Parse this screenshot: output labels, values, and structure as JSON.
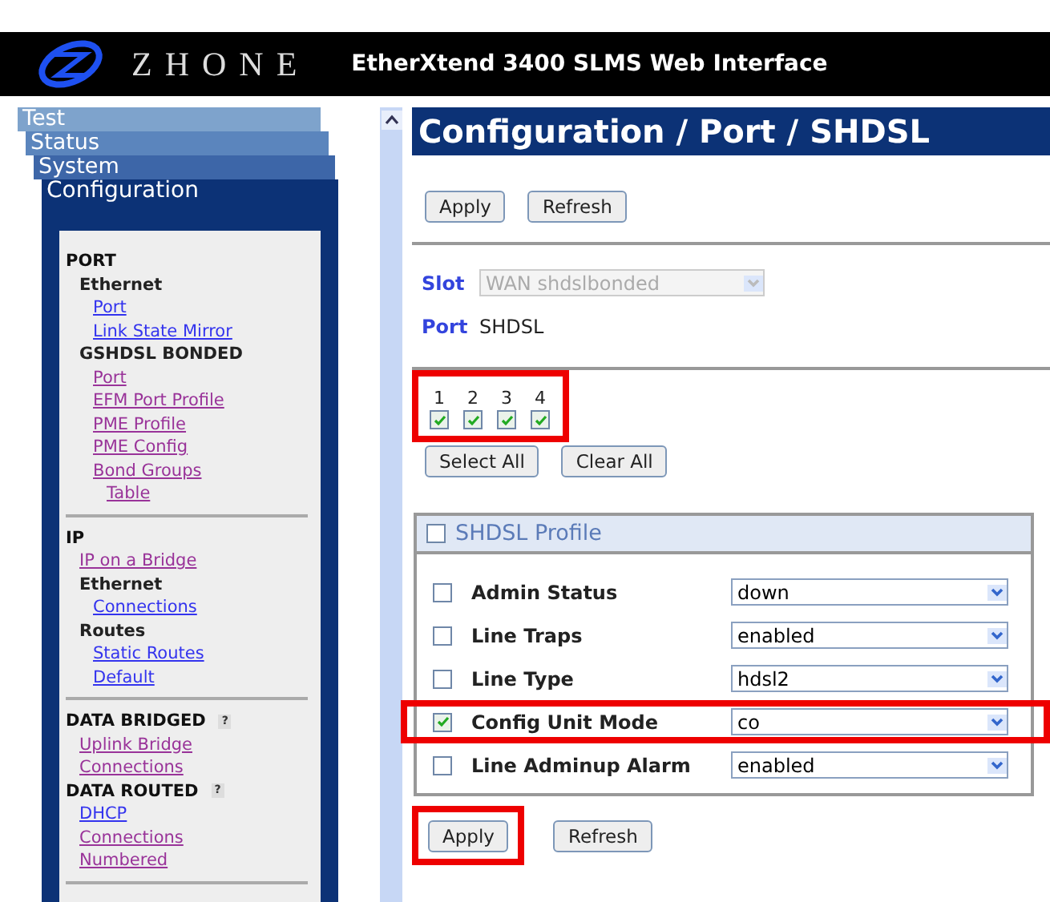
{
  "header": {
    "brand": "ZHONE",
    "title": "EtherXtend 3400 SLMS Web Interface"
  },
  "nav_tabs": [
    {
      "label": "Test",
      "selected": false
    },
    {
      "label": "Status",
      "selected": false
    },
    {
      "label": "System",
      "selected": false
    },
    {
      "label": "Configuration",
      "selected": true
    }
  ],
  "sidebar": {
    "sections": [
      {
        "items": [
          {
            "label": "PORT",
            "kind": "title",
            "children": [
              {
                "label": "Ethernet",
                "kind": "group",
                "children": [
                  {
                    "label": "Port",
                    "kind": "link",
                    "visited": false
                  },
                  {
                    "label": "Link State Mirror",
                    "kind": "link",
                    "visited": false
                  }
                ]
              },
              {
                "label": "GSHDSL BONDED",
                "kind": "group",
                "children": [
                  {
                    "label": "Port",
                    "kind": "link",
                    "visited": true
                  },
                  {
                    "label": "EFM Port Profile",
                    "kind": "link",
                    "visited": true
                  },
                  {
                    "label": "PME Profile",
                    "kind": "link",
                    "visited": true
                  },
                  {
                    "label": "PME Config",
                    "kind": "link",
                    "visited": true
                  },
                  {
                    "label": "Bond Groups",
                    "kind": "link",
                    "visited": true,
                    "children": [
                      {
                        "label": "Table",
                        "kind": "link",
                        "visited": true
                      }
                    ]
                  }
                ]
              }
            ]
          }
        ]
      },
      {
        "items": [
          {
            "label": "IP",
            "kind": "title",
            "children": [
              {
                "label": "IP on a Bridge",
                "kind": "link",
                "visited": true
              },
              {
                "label": "Ethernet",
                "kind": "group",
                "children": [
                  {
                    "label": "Connections",
                    "kind": "link",
                    "visited": false
                  }
                ]
              },
              {
                "label": "Routes",
                "kind": "group",
                "children": [
                  {
                    "label": "Static Routes",
                    "kind": "link",
                    "visited": false
                  },
                  {
                    "label": "Default",
                    "kind": "link",
                    "visited": false
                  }
                ]
              }
            ]
          }
        ]
      },
      {
        "items": [
          {
            "label": "DATA BRIDGED",
            "kind": "title",
            "help": "?",
            "children": [
              {
                "label": "Uplink Bridge",
                "kind": "link",
                "visited": true
              },
              {
                "label": "Connections",
                "kind": "link",
                "visited": true
              }
            ]
          },
          {
            "label": "DATA ROUTED",
            "kind": "title",
            "help": "?",
            "children": [
              {
                "label": "DHCP",
                "kind": "link",
                "visited": false
              },
              {
                "label": "Connections",
                "kind": "link",
                "visited": true
              },
              {
                "label": "Numbered",
                "kind": "link",
                "visited": true
              }
            ]
          }
        ]
      }
    ]
  },
  "page_title": "Configuration / Port / SHDSL",
  "top_buttons": [
    "Apply",
    "Refresh"
  ],
  "slot": {
    "label": "Slot",
    "value": "WAN shdslbonded",
    "disabled": true
  },
  "port": {
    "label": "Port",
    "value": "SHDSL"
  },
  "port_checks": {
    "highlight": true,
    "items": [
      {
        "label": "1",
        "checked": true
      },
      {
        "label": "2",
        "checked": true
      },
      {
        "label": "3",
        "checked": true
      },
      {
        "label": "4",
        "checked": true
      }
    ]
  },
  "select_buttons": [
    "Select All",
    "Clear All"
  ],
  "profile": {
    "title": "SHDSL Profile",
    "checked": false,
    "rows": [
      {
        "label": "Admin Status",
        "value": "down",
        "checked": false,
        "highlight": false
      },
      {
        "label": "Line Traps",
        "value": "enabled",
        "checked": false,
        "highlight": false
      },
      {
        "label": "Line Type",
        "value": "hdsl2",
        "checked": false,
        "highlight": false
      },
      {
        "label": "Config Unit Mode",
        "value": "co",
        "checked": true,
        "highlight": true
      },
      {
        "label": "Line Adminup Alarm",
        "value": "enabled",
        "checked": false,
        "highlight": false
      }
    ]
  },
  "bottom_buttons": [
    {
      "label": "Apply",
      "highlight": true
    },
    {
      "label": "Refresh",
      "highlight": false
    }
  ]
}
